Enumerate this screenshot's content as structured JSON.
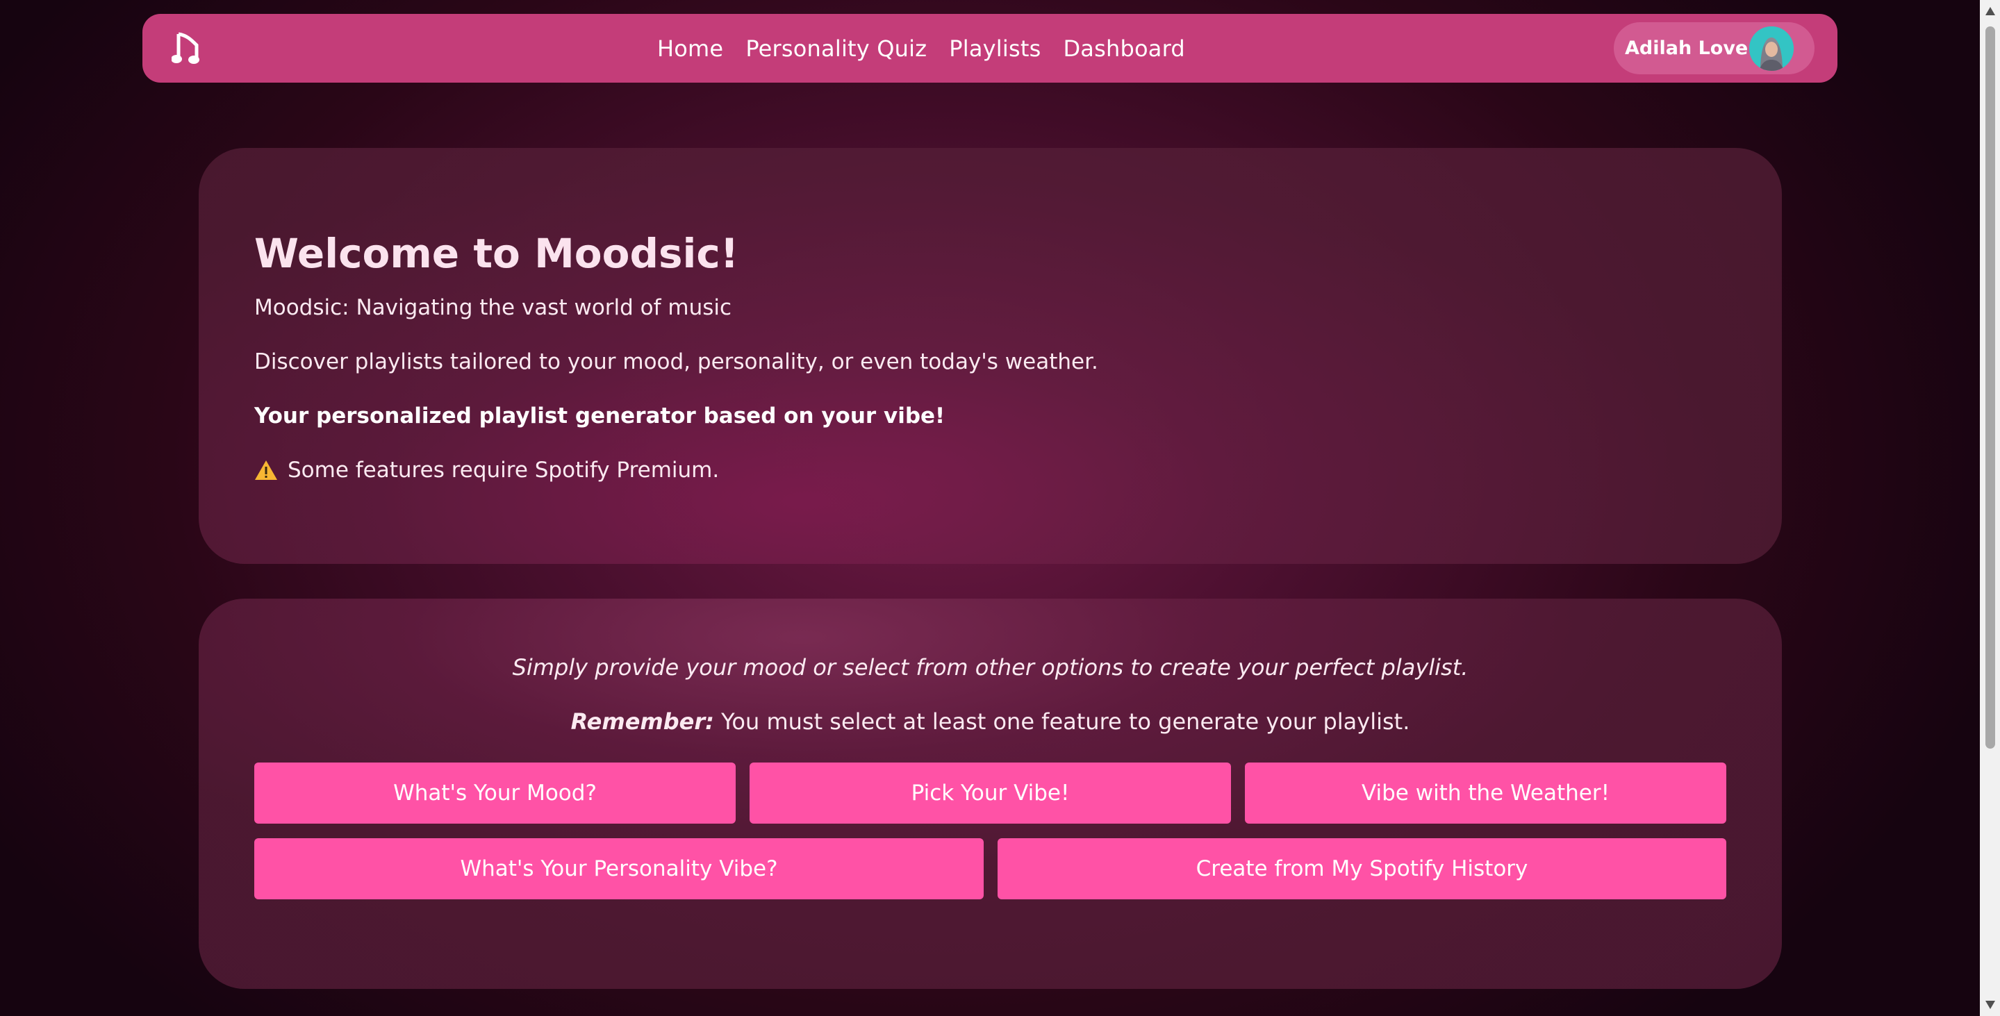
{
  "nav": {
    "logo_icon": "music-note-icon",
    "links": [
      "Home",
      "Personality Quiz",
      "Playlists",
      "Dashboard"
    ],
    "user_name": "Adilah Love",
    "colors": {
      "nav_bg": "#c43d79",
      "pill_bg": "#d25a91"
    }
  },
  "welcome": {
    "title": "Welcome to Moodsic!",
    "tagline": "Moodsic: Navigating the vast world of music",
    "description": "Discover playlists tailored to your mood, personality, or even today's weather.",
    "highlight": "Your personalized playlist generator based on your vibe!",
    "warning_icon": "warning-icon",
    "warning": "Some features require Spotify Premium."
  },
  "options": {
    "intro": "Simply provide your mood or select from other options to create your perfect playlist.",
    "remember_label": "Remember:",
    "remember_text": "You must select at least one feature to generate your playlist.",
    "buttons": [
      "What's Your Mood?",
      "Pick Your Vibe!",
      "Vibe with the Weather!",
      "What's Your Personality Vibe?",
      "Create from My Spotify History"
    ],
    "colors": {
      "button_bg": "#ff52a6"
    }
  }
}
